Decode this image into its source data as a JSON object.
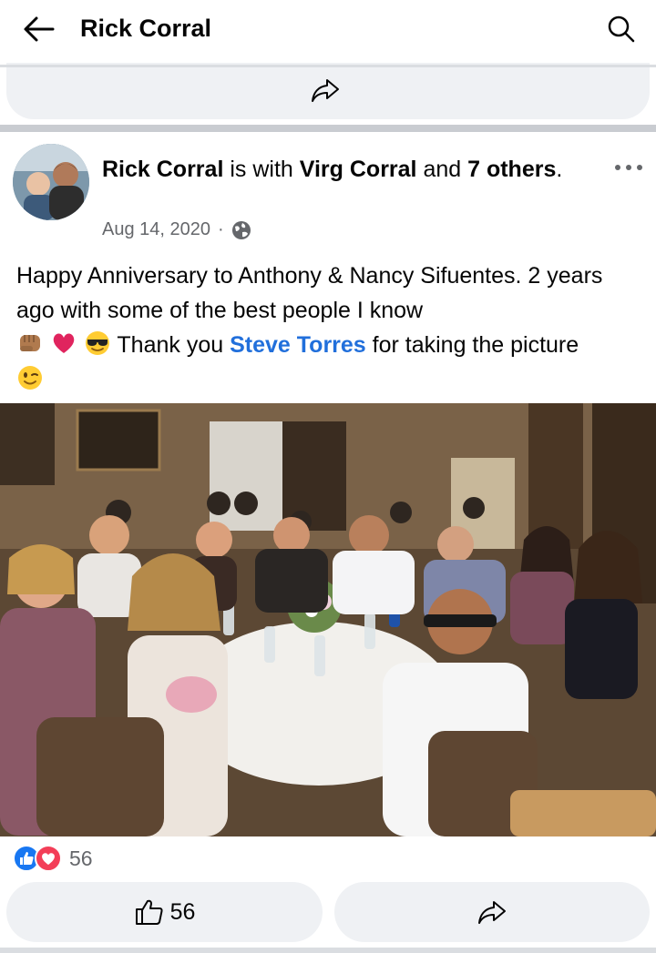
{
  "header": {
    "title": "Rick Corral",
    "back_icon": "arrow-left-icon",
    "search_icon": "search-icon"
  },
  "post": {
    "author": "Rick Corral",
    "is_with_text": " is with ",
    "tagged_person": "Virg Corral",
    "and_text": " and ",
    "others_count_text": "7 others",
    "period": ".",
    "date": "Aug 14, 2020",
    "dot": "·",
    "audience_icon": "globe-icon",
    "text_line1": "Happy Anniversary to Anthony & Nancy Sifuentes. 2 years ago with some of the best people I know",
    "emojis": [
      "fist-icon",
      "heart-icon",
      "sunglasses-face-icon"
    ],
    "text_thank": " Thank you ",
    "mention": "Steve Torres",
    "text_after_mention": " for taking the picture",
    "end_emoji": "winking-face-icon"
  },
  "reactions": {
    "icons": [
      "like-reaction-icon",
      "love-reaction-icon"
    ],
    "count": "56"
  },
  "actions": {
    "like_count": "56",
    "like_icon": "thumbs-up-icon",
    "share_icon": "share-icon"
  },
  "colors": {
    "link": "#216fdb",
    "muted": "#65676b",
    "button_bg": "#eff1f4",
    "like_blue": "#1877f2",
    "love_red": "#f33e58"
  }
}
